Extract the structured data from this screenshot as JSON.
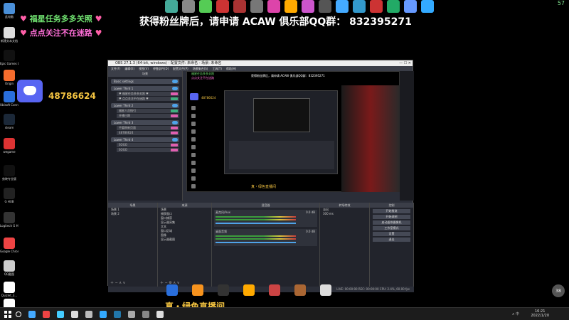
{
  "overlay": {
    "line1": "福星任务多多关照",
    "line2": "点点关注不在迷路",
    "heart": "♥",
    "group_banner": "获得粉丝牌后，请申请 ACAW 俱乐部QQ群：  832395271",
    "discord_id": "48786624",
    "footer_title": "真・绿色直播间",
    "fps": "57"
  },
  "desktop": {
    "icons": [
      {
        "label": "此电脑",
        "color": "#4a90d9"
      },
      {
        "label": "新建文本文档",
        "color": "#ddd"
      },
      {
        "label": "Epic Games Launcher",
        "color": "#111"
      },
      {
        "label": "Origin",
        "color": "#f56c2d"
      },
      {
        "label": "Ubisoft Connect",
        "color": "#2a6fdc"
      },
      {
        "label": "steam",
        "color": "#1b2838"
      },
      {
        "label": "wegame",
        "color": "#d33"
      },
      {
        "label": "剪映专业版",
        "color": "#111"
      },
      {
        "label": "G HUB",
        "color": "#222"
      },
      {
        "label": "Logitech G HUB",
        "color": "#333"
      },
      {
        "label": "Google Chrome",
        "color": "#e44"
      },
      {
        "label": "QQ截图",
        "color": "#ccc"
      },
      {
        "label": "Quizlet_3...",
        "color": "#fff"
      },
      {
        "label": "Quizlet_3...",
        "color": "#fff"
      }
    ],
    "top_app_colors": [
      "#4a9",
      "#888",
      "#5c5",
      "#c33",
      "#a33",
      "#777",
      "#d4a",
      "#fa0",
      "#c5c",
      "#555",
      "#4af",
      "#39c",
      "#c33",
      "#2a6",
      "#69f",
      "#3af"
    ],
    "bottom_apps": [
      "#2a6fdc",
      "#f7931e",
      "#333",
      "#fa0",
      "#c44",
      "#a63",
      "#ddd"
    ],
    "taskbar_app_colors": [
      "#4af",
      "#e44",
      "#4cf",
      "#ddd",
      "#bbb",
      "#3af",
      "#27a",
      "#aaa",
      "#888",
      "#ddd"
    ]
  },
  "obs": {
    "title": "OBS 27.1.3 (64-bit, windows) - 配置文件: 未命名 - 场景: 未命名",
    "menu": [
      "文件(F)",
      "编辑(E)",
      "视图(V)",
      "停靠部件(D)",
      "配置文件(P)",
      "场景集合(S)",
      "工具(T)",
      "帮助(H)"
    ],
    "side_title": "场景",
    "scenes": [
      {
        "name": "Basic settings"
      },
      {
        "name": "Lower Third 1",
        "subs": [
          "♥ 福星任务多多关照 ♥",
          "♥ 点点关注不在迷路 ♥"
        ]
      },
      {
        "name": "Lower Third 2",
        "subs": [
          "福星人员指引",
          "开播日期"
        ]
      },
      {
        "name": "Lower Third 3",
        "subs": [
          "不要刷新页面",
          "48786624"
        ]
      },
      {
        "name": "Lower Third 4",
        "subs": [
          "SOGO",
          "SOGO"
        ]
      }
    ],
    "preview_top": "获得粉丝牌后，请申请 ACAW 俱乐部QQ群：832395271",
    "preview_bottom": "真・绿色直播间",
    "preview_id": "48786624",
    "docks": {
      "scenes_head": "场景",
      "scene_items": [
        "场景 1",
        "场景 2"
      ],
      "sources_head": "来源",
      "source_items": [
        "场景",
        "捕获窗口",
        "窗口捕获",
        "显示器采集",
        "文本",
        "窗口区域",
        "图像",
        "显示器截图"
      ],
      "mixer_head": "混音器",
      "mixer": [
        {
          "name": "麦克风/Aux",
          "db": "0.0 dB"
        },
        {
          "name": "桌面音频",
          "db": "0.0 dB"
        }
      ],
      "transition_head": "转场特效",
      "transition_type": "淡出",
      "transition_duration": "300 ms",
      "controls_head": "控制",
      "controls": [
        "开始推流",
        "开始录制",
        "启动虚拟摄像机",
        "工作室模式",
        "设置",
        "退出"
      ]
    },
    "status": "LIVE: 00:00:00   REC: 00:00:00   CPU: 2.4%, 60.00 fps"
  },
  "taskbar": {
    "time": "16:21",
    "date": "2022/1/20",
    "tray": "∧ 中"
  }
}
